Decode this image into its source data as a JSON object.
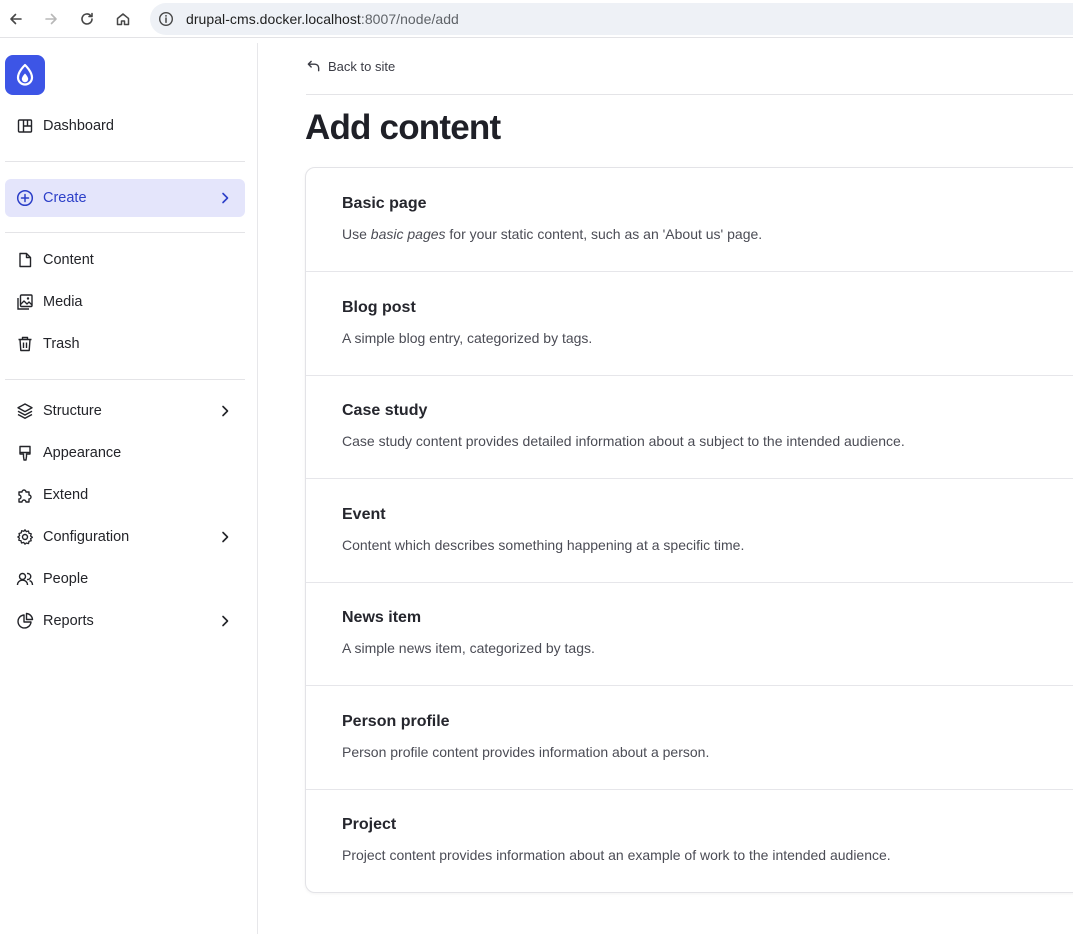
{
  "browser": {
    "url_host": "drupal-cms.docker.localhost",
    "url_path": ":8007/node/add"
  },
  "sidebar": {
    "items": [
      {
        "label": "Dashboard",
        "icon": "dashboard-icon"
      },
      {
        "label": "Create",
        "icon": "plus-circle-icon",
        "active": true,
        "has_children": true
      },
      {
        "label": "Content",
        "icon": "document-icon"
      },
      {
        "label": "Media",
        "icon": "media-icon"
      },
      {
        "label": "Trash",
        "icon": "trash-icon"
      },
      {
        "label": "Structure",
        "icon": "layers-icon",
        "has_children": true
      },
      {
        "label": "Appearance",
        "icon": "paint-brush-icon"
      },
      {
        "label": "Extend",
        "icon": "puzzle-icon"
      },
      {
        "label": "Configuration",
        "icon": "gear-icon",
        "has_children": true
      },
      {
        "label": "People",
        "icon": "people-icon"
      },
      {
        "label": "Reports",
        "icon": "pie-chart-icon",
        "has_children": true
      }
    ]
  },
  "main": {
    "back_label": "Back to site",
    "title": "Add content",
    "content_types": [
      {
        "title": "Basic page",
        "desc_pre": "Use ",
        "desc_em": "basic pages",
        "desc_post": " for your static content, such as an 'About us' page."
      },
      {
        "title": "Blog post",
        "desc_pre": "A simple blog entry, categorized by tags.",
        "desc_em": "",
        "desc_post": ""
      },
      {
        "title": "Case study",
        "desc_pre": "Case study content provides detailed information about a subject to the intended audience.",
        "desc_em": "",
        "desc_post": ""
      },
      {
        "title": "Event",
        "desc_pre": "Content which describes something happening at a specific time.",
        "desc_em": "",
        "desc_post": ""
      },
      {
        "title": "News item",
        "desc_pre": "A simple news item, categorized by tags.",
        "desc_em": "",
        "desc_post": ""
      },
      {
        "title": "Person profile",
        "desc_pre": "Person profile content provides information about a person.",
        "desc_em": "",
        "desc_post": ""
      },
      {
        "title": "Project",
        "desc_pre": "Project content provides information about an example of work to the intended audience.",
        "desc_em": "",
        "desc_post": ""
      }
    ]
  },
  "colors": {
    "accent": "#3d55e6",
    "active_bg": "#e4e5fb",
    "active_text": "#2c3fc8"
  }
}
